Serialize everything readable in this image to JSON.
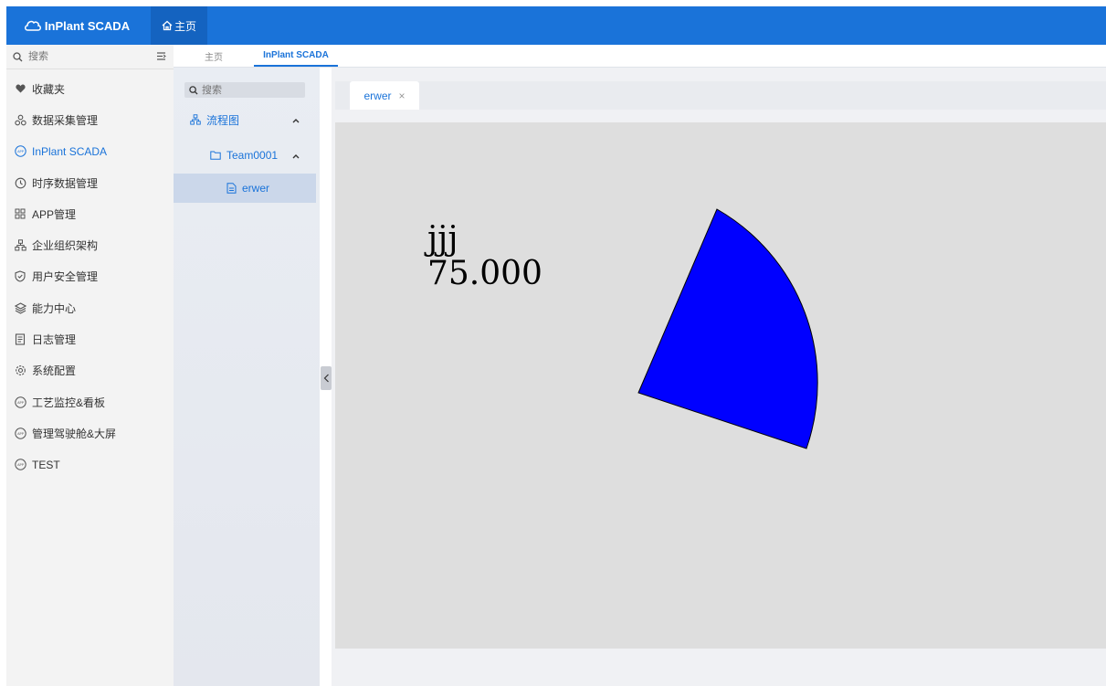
{
  "brand": {
    "name": "InPlant SCADA"
  },
  "topbar": {
    "home_label": "主页"
  },
  "sidebar": {
    "search_placeholder": "搜索",
    "items": [
      {
        "label": "收藏夹",
        "icon": "heart-icon"
      },
      {
        "label": "数据采集管理",
        "icon": "nodes-icon"
      },
      {
        "label": "InPlant SCADA",
        "icon": "app-icon",
        "active": true
      },
      {
        "label": "时序数据管理",
        "icon": "clock-icon"
      },
      {
        "label": "APP管理",
        "icon": "grid-icon"
      },
      {
        "label": "企业组织架构",
        "icon": "org-icon"
      },
      {
        "label": "用户安全管理",
        "icon": "shield-icon"
      },
      {
        "label": "能力中心",
        "icon": "layers-icon"
      },
      {
        "label": "日志管理",
        "icon": "document-icon"
      },
      {
        "label": "系统配置",
        "icon": "gear-icon"
      },
      {
        "label": "工艺监控&看板",
        "icon": "app-icon"
      },
      {
        "label": "管理驾驶舱&大屏",
        "icon": "app-icon"
      },
      {
        "label": "TEST",
        "icon": "app-icon"
      }
    ]
  },
  "tabs": {
    "home": "主页",
    "scada": "InPlant SCADA"
  },
  "tree": {
    "search_placeholder": "搜索",
    "flow_label": "流程图",
    "team_label": "Team0001",
    "file_label": "erwer"
  },
  "doc_tab": {
    "label": "erwer",
    "close": "×"
  },
  "canvas": {
    "text_line1": "jjj",
    "text_line2": "75.000",
    "gauge_value": 75,
    "sector_fill": "#0000ff"
  },
  "colors": {
    "accent": "#1a73d9",
    "topbar": "#1a73d9",
    "sector": "#0000ff"
  }
}
